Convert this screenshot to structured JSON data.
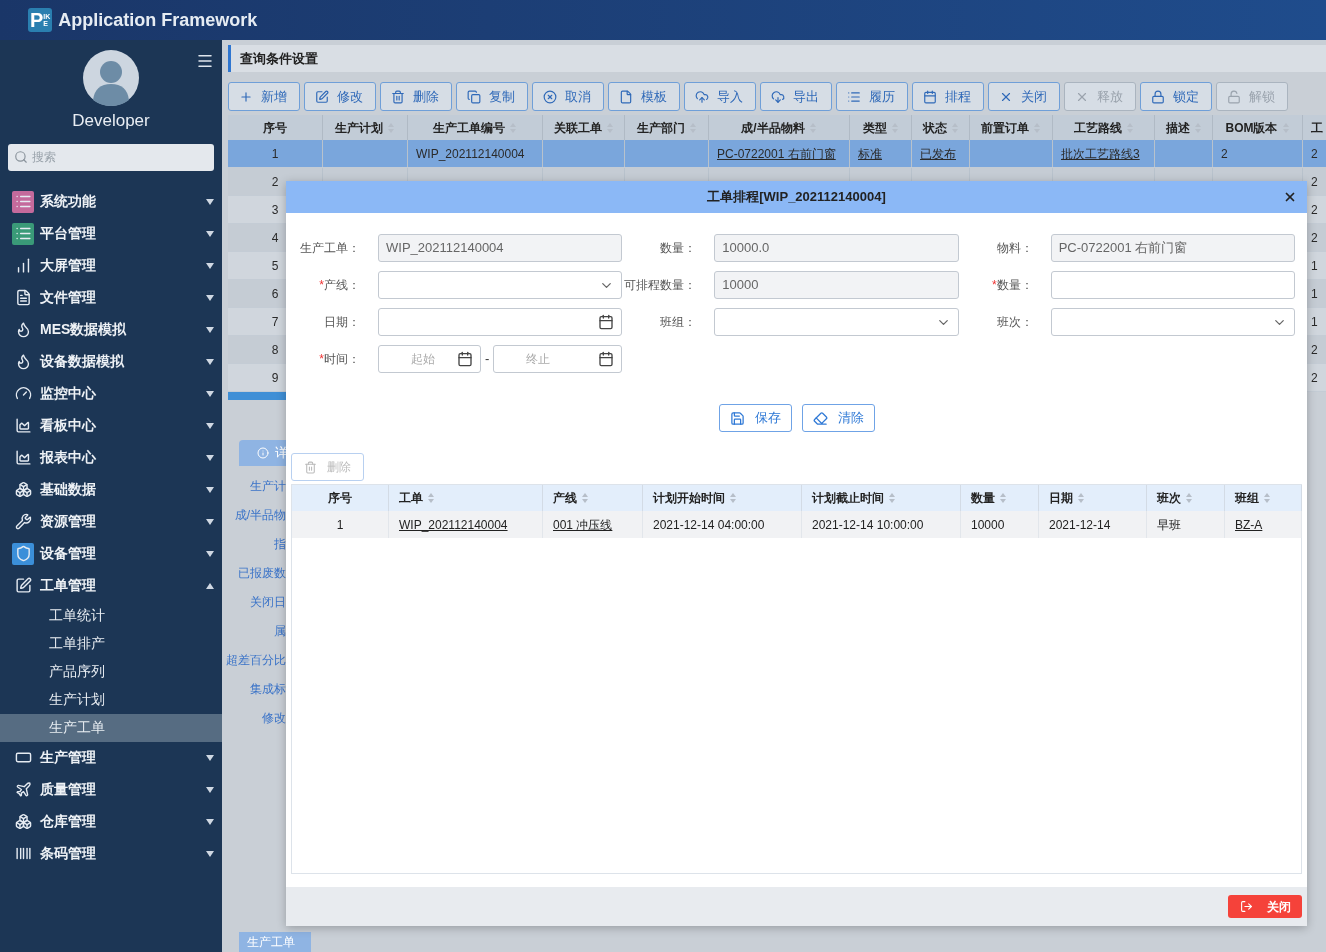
{
  "header": {
    "logo_main": "P",
    "logo_side": "IKE",
    "title": "Application Framework"
  },
  "sidebar": {
    "user": "Developer",
    "search_placeholder": "搜索",
    "items": [
      {
        "label": "系统功能",
        "expanded": false
      },
      {
        "label": "平台管理",
        "expanded": false
      },
      {
        "label": "大屏管理",
        "expanded": false
      },
      {
        "label": "文件管理",
        "expanded": false
      },
      {
        "label": "MES数据模拟",
        "expanded": false
      },
      {
        "label": "设备数据模拟",
        "expanded": false
      },
      {
        "label": "监控中心",
        "expanded": false
      },
      {
        "label": "看板中心",
        "expanded": false
      },
      {
        "label": "报表中心",
        "expanded": false
      },
      {
        "label": "基础数据",
        "expanded": false
      },
      {
        "label": "资源管理",
        "expanded": false
      },
      {
        "label": "设备管理",
        "expanded": false
      },
      {
        "label": "工单管理",
        "expanded": true,
        "children": [
          {
            "label": "工单统计",
            "selected": false
          },
          {
            "label": "工单排产",
            "selected": false
          },
          {
            "label": "产品序列",
            "selected": false
          },
          {
            "label": "生产计划",
            "selected": false
          },
          {
            "label": "生产工单",
            "selected": true
          }
        ]
      },
      {
        "label": "生产管理",
        "expanded": false
      },
      {
        "label": "质量管理",
        "expanded": false
      },
      {
        "label": "仓库管理",
        "expanded": false
      },
      {
        "label": "条码管理",
        "expanded": false
      }
    ]
  },
  "panel_title": "查询条件设置",
  "toolbar": [
    {
      "label": "新增",
      "disabled": false
    },
    {
      "label": "修改",
      "disabled": false
    },
    {
      "label": "删除",
      "disabled": false
    },
    {
      "label": "复制",
      "disabled": false
    },
    {
      "label": "取消",
      "disabled": false
    },
    {
      "label": "模板",
      "disabled": false
    },
    {
      "label": "导入",
      "disabled": false
    },
    {
      "label": "导出",
      "disabled": false
    },
    {
      "label": "履历",
      "disabled": false
    },
    {
      "label": "排程",
      "disabled": false
    },
    {
      "label": "关闭",
      "disabled": false
    },
    {
      "label": "释放",
      "disabled": true
    },
    {
      "label": "锁定",
      "disabled": false
    },
    {
      "label": "解锁",
      "disabled": true
    }
  ],
  "table": {
    "columns": [
      {
        "label": "序号",
        "sortable": false
      },
      {
        "label": "生产计划",
        "sortable": true
      },
      {
        "label": "生产工单编号",
        "sortable": true
      },
      {
        "label": "关联工单",
        "sortable": true
      },
      {
        "label": "生产部门",
        "sortable": true
      },
      {
        "label": "成/半品物料",
        "sortable": true
      },
      {
        "label": "类型",
        "sortable": true
      },
      {
        "label": "状态",
        "sortable": true
      },
      {
        "label": "前置订单",
        "sortable": true
      },
      {
        "label": "工艺路线",
        "sortable": true
      },
      {
        "label": "描述",
        "sortable": true
      },
      {
        "label": "BOM版本",
        "sortable": true
      },
      {
        "label": "工"
      }
    ],
    "rows": [
      {
        "selected": true,
        "cells": [
          {
            "text": "1",
            "link": false
          },
          null,
          {
            "text": "WIP_202112140004",
            "link": false
          },
          null,
          null,
          {
            "text": "PC-0722001 右前门窗",
            "link": true
          },
          {
            "text": "标准",
            "link": true
          },
          {
            "text": "已发布",
            "link": true
          },
          null,
          {
            "text": "批次工艺路线3",
            "link": true
          },
          null,
          {
            "text": "2",
            "link": false
          },
          {
            "text": "2",
            "link": false
          }
        ]
      },
      {
        "selected": false,
        "cells": [
          {
            "text": "2",
            "link": false
          },
          null,
          null,
          null,
          null,
          null,
          null,
          null,
          null,
          null,
          null,
          null,
          {
            "text": "2",
            "link": false
          }
        ]
      },
      {
        "selected": false,
        "cells": [
          {
            "text": "3",
            "link": false
          },
          null,
          null,
          null,
          null,
          null,
          null,
          null,
          null,
          null,
          null,
          null,
          {
            "text": "2",
            "link": false
          }
        ]
      },
      {
        "selected": false,
        "cells": [
          {
            "text": "4",
            "link": false
          },
          null,
          null,
          null,
          null,
          null,
          null,
          null,
          null,
          null,
          null,
          null,
          {
            "text": "2",
            "link": false
          }
        ]
      },
      {
        "selected": false,
        "cells": [
          {
            "text": "5",
            "link": false
          },
          null,
          null,
          null,
          null,
          null,
          null,
          null,
          null,
          null,
          null,
          null,
          {
            "text": "1",
            "link": false
          }
        ]
      },
      {
        "selected": false,
        "cells": [
          {
            "text": "6",
            "link": false
          },
          null,
          null,
          null,
          null,
          null,
          null,
          null,
          null,
          null,
          null,
          null,
          {
            "text": "1",
            "link": false
          }
        ]
      },
      {
        "selected": false,
        "cells": [
          {
            "text": "7",
            "link": false
          },
          null,
          null,
          null,
          null,
          null,
          null,
          null,
          null,
          null,
          null,
          null,
          {
            "text": "1",
            "link": false
          }
        ]
      },
      {
        "selected": false,
        "cells": [
          {
            "text": "8",
            "link": false
          },
          null,
          null,
          null,
          null,
          null,
          null,
          null,
          null,
          null,
          null,
          null,
          {
            "text": "2",
            "link": false
          }
        ]
      },
      {
        "selected": false,
        "cells": [
          {
            "text": "9",
            "link": false
          },
          null,
          null,
          null,
          null,
          null,
          null,
          null,
          null,
          null,
          null,
          null,
          {
            "text": "2",
            "link": false
          }
        ]
      }
    ]
  },
  "detail": {
    "tab": "详",
    "labels": [
      "生产计",
      "成/半品物",
      "指",
      "已报废数",
      "关闭日",
      "属",
      "超差百分比",
      "集成标",
      "修改"
    ],
    "bottom_tab": "生产工单"
  },
  "modal": {
    "title": "工单排程[WIP_202112140004]",
    "required_mark": "*",
    "fields": [
      {
        "label": "生产工单：",
        "kind": "text",
        "required": false,
        "disabled": true,
        "value": "WIP_202112140004"
      },
      {
        "label": "数量：",
        "kind": "text",
        "required": false,
        "disabled": true,
        "value": "10000.0"
      },
      {
        "label": "物料：",
        "kind": "text",
        "required": false,
        "disabled": true,
        "value": "PC-0722001 右前门窗"
      },
      {
        "label": "产线：",
        "kind": "select",
        "required": true,
        "disabled": false
      },
      {
        "label": "可排程数量：",
        "kind": "text",
        "required": false,
        "disabled": true,
        "value": "10000"
      },
      {
        "label": "数量：",
        "kind": "text",
        "required": true,
        "disabled": false
      },
      {
        "label": "日期：",
        "kind": "date",
        "required": false,
        "disabled": false
      },
      {
        "label": "班组：",
        "kind": "select",
        "required": false,
        "disabled": false
      },
      {
        "label": "班次：",
        "kind": "select",
        "required": false,
        "disabled": false
      },
      {
        "label": "时间：",
        "kind": "range",
        "required": true,
        "disabled": false,
        "start_placeholder": "起始",
        "end_placeholder": "终止",
        "separator": "-"
      }
    ],
    "buttons": [
      "保存",
      "清除"
    ],
    "delete_button": {
      "label": "删除",
      "disabled": true
    },
    "grid": {
      "columns": [
        {
          "label": "序号",
          "sortable": false
        },
        {
          "label": "工单",
          "sortable": true
        },
        {
          "label": "产线",
          "sortable": true
        },
        {
          "label": "计划开始时间",
          "sortable": true
        },
        {
          "label": "计划截止时间",
          "sortable": true
        },
        {
          "label": "数量",
          "sortable": true
        },
        {
          "label": "日期",
          "sortable": true
        },
        {
          "label": "班次",
          "sortable": true
        },
        {
          "label": "班组",
          "sortable": true
        }
      ],
      "rows": [
        {
          "cells": [
            {
              "text": "1",
              "link": false
            },
            {
              "text": "WIP_202112140004",
              "link": true
            },
            {
              "text": "001 冲压线",
              "link": true
            },
            {
              "text": "2021-12-14 04:00:00",
              "link": false
            },
            {
              "text": "2021-12-14 10:00:00",
              "link": false
            },
            {
              "text": "10000",
              "link": false
            },
            {
              "text": "2021-12-14",
              "link": false
            },
            {
              "text": "早班",
              "link": false
            },
            {
              "text": "BZ-A",
              "link": true
            }
          ]
        }
      ]
    },
    "close_button": "关闭"
  }
}
